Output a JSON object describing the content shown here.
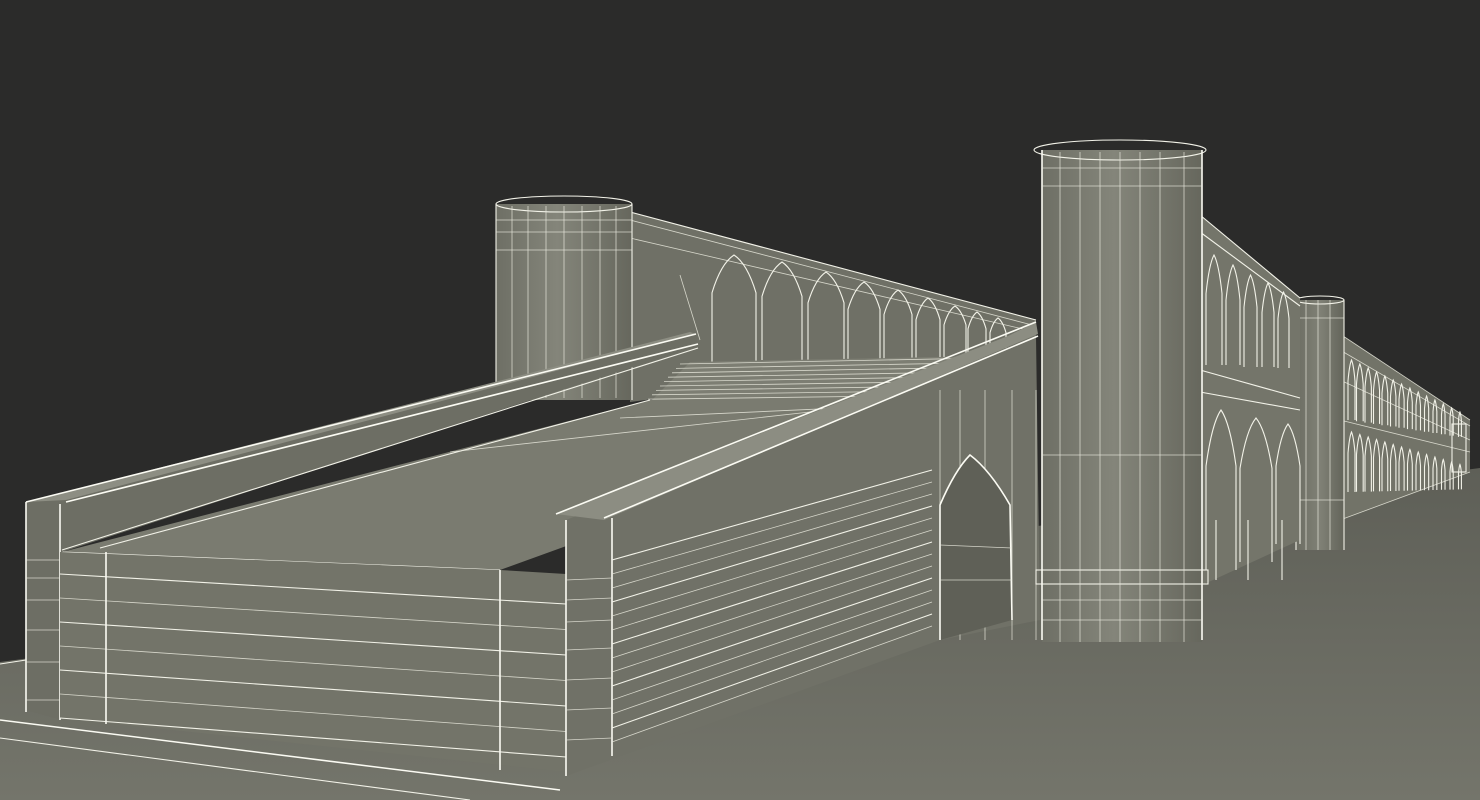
{
  "scene": {
    "subject": "wireframe-3d-model-stone-bridge",
    "background_color": "#2b2b2a",
    "ground_color": "#6b6c63",
    "surface_color": "#7c7d72",
    "surface_dark_color": "#66675d",
    "wire_color": "#f2f2e8"
  }
}
